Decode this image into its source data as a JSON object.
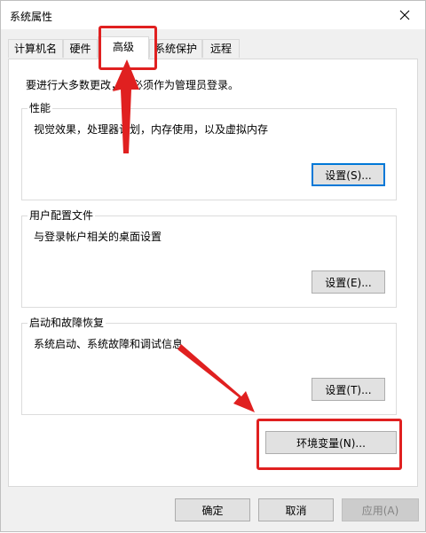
{
  "window": {
    "title": "系统属性",
    "close_icon": "close-icon"
  },
  "tabs": [
    {
      "label": "计算机名",
      "active": false
    },
    {
      "label": "硬件",
      "active": false
    },
    {
      "label": "高级",
      "active": true
    },
    {
      "label": "系统保护",
      "active": false
    },
    {
      "label": "远程",
      "active": false
    }
  ],
  "advanced": {
    "admin_note": "要进行大多数更改，你必须作为管理员登录。",
    "performance": {
      "label": "性能",
      "description": "视觉效果，处理器计划，内存使用，以及虚拟内存",
      "button": "设置(S)..."
    },
    "user_profiles": {
      "label": "用户配置文件",
      "description": "与登录帐户相关的桌面设置",
      "button": "设置(E)..."
    },
    "startup_recovery": {
      "label": "启动和故障恢复",
      "description": "系统启动、系统故障和调试信息",
      "button": "设置(T)..."
    },
    "env_button": "环境变量(N)..."
  },
  "footer": {
    "ok": "确定",
    "cancel": "取消",
    "apply": "应用(A)"
  },
  "annotation": {
    "color": "#e02020"
  }
}
